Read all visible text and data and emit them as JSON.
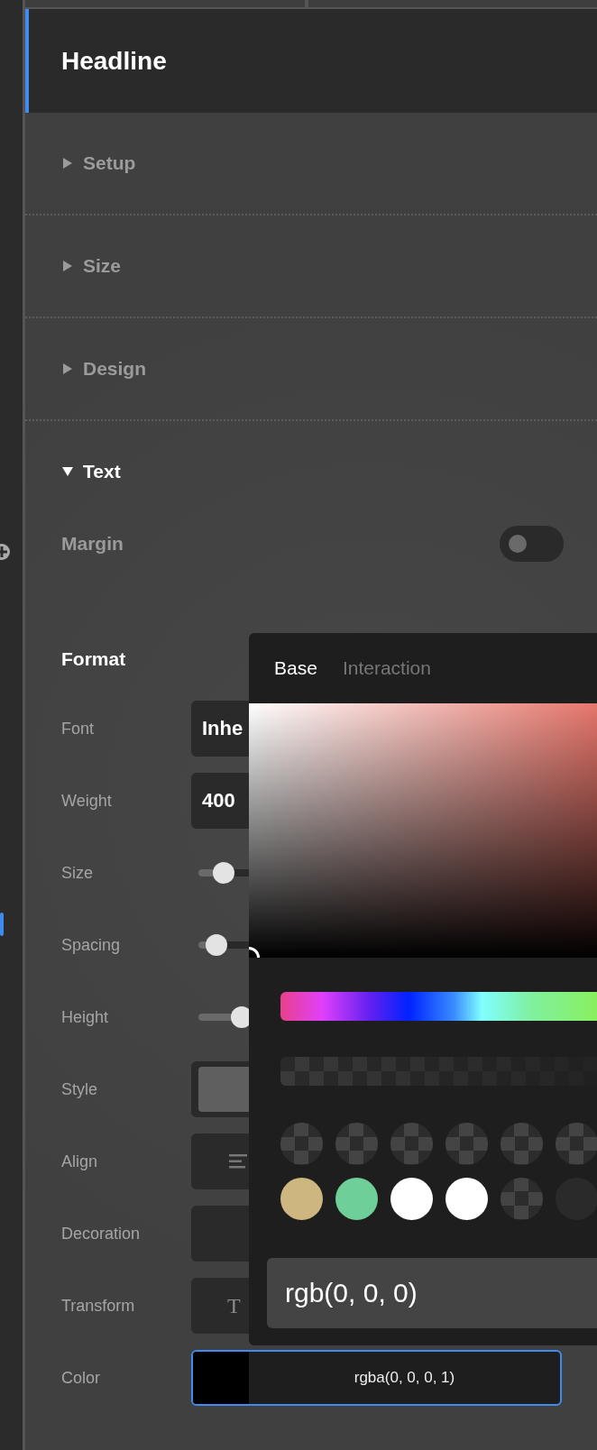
{
  "panel_title": "Headline",
  "sections": [
    {
      "title": "Setup",
      "expanded": false
    },
    {
      "title": "Size",
      "expanded": false
    },
    {
      "title": "Design",
      "expanded": false
    },
    {
      "title": "Text",
      "expanded": true
    }
  ],
  "margin": {
    "label": "Margin",
    "on": false
  },
  "format": {
    "title": "Format",
    "rows": [
      {
        "label": "Font",
        "kind": "select",
        "value": "Inhe"
      },
      {
        "label": "Weight",
        "kind": "select",
        "value": "400"
      },
      {
        "label": "Size",
        "kind": "slider",
        "level": 0.07
      },
      {
        "label": "Spacing",
        "kind": "slider",
        "level": 0.05
      },
      {
        "label": "Height",
        "kind": "slider",
        "level": 0.12
      },
      {
        "label": "Style",
        "kind": "style"
      },
      {
        "label": "Align",
        "kind": "align"
      },
      {
        "label": "Decoration",
        "kind": "blank"
      },
      {
        "label": "Transform",
        "kind": "glyph",
        "value": "T"
      },
      {
        "label": "Color",
        "kind": "color",
        "value": "rgba(0, 0, 0, 1)",
        "color": "#000000"
      }
    ]
  },
  "color_picker": {
    "tabs": [
      {
        "label": "Base",
        "selected": true
      },
      {
        "label": "Interaction",
        "selected": false
      }
    ],
    "swatches": [
      {
        "kind": "empty"
      },
      {
        "kind": "empty"
      },
      {
        "kind": "empty"
      },
      {
        "kind": "empty"
      },
      {
        "kind": "empty"
      },
      {
        "kind": "empty"
      },
      {
        "kind": "color",
        "color": "#cdb67f"
      },
      {
        "kind": "color",
        "color": "#6fcf99"
      },
      {
        "kind": "color",
        "color": "#ffffff"
      },
      {
        "kind": "color",
        "color": "#ffffff"
      },
      {
        "kind": "empty"
      },
      {
        "kind": "color",
        "color": "#2a2a2a"
      }
    ],
    "value": "rgb(0, 0, 0)"
  }
}
